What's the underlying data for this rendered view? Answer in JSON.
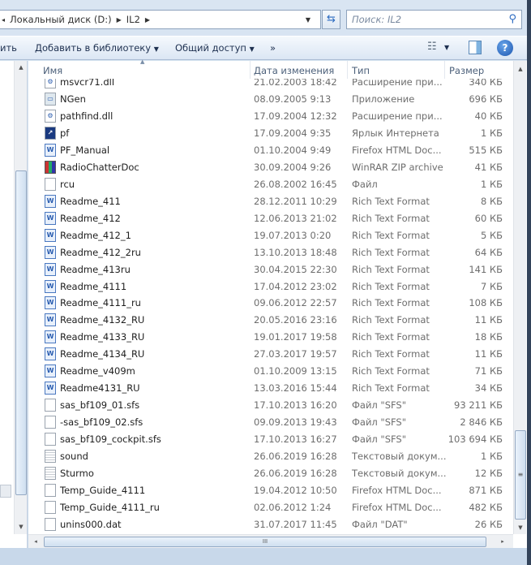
{
  "address": {
    "parts": [
      "Локальный диск (D:)",
      "IL2"
    ]
  },
  "search": {
    "placeholder": "Поиск: IL2"
  },
  "toolbar": {
    "cut_label": "ить",
    "library_label": "Добавить в библиотеку",
    "share_label": "Общий доступ",
    "more_label": "»"
  },
  "columns": {
    "name": "Имя",
    "date": "Дата изменения",
    "type": "Тип",
    "size": "Размер"
  },
  "files": [
    {
      "name": "msvcr71.dll",
      "date": "21.02.2003 18:42",
      "type": "Расширение при...",
      "size": "340 КБ",
      "icon": "dll"
    },
    {
      "name": "NGen",
      "date": "08.09.2005 9:13",
      "type": "Приложение",
      "size": "696 КБ",
      "icon": "app"
    },
    {
      "name": "pathfind.dll",
      "date": "17.09.2004 12:32",
      "type": "Расширение при...",
      "size": "40 КБ",
      "icon": "dll"
    },
    {
      "name": "pf",
      "date": "17.09.2004 9:35",
      "type": "Ярлык Интернета",
      "size": "1 КБ",
      "icon": "url"
    },
    {
      "name": "PF_Manual",
      "date": "01.10.2004 9:49",
      "type": "Firefox HTML Doc...",
      "size": "515 КБ",
      "icon": "rtf"
    },
    {
      "name": "RadioChatterDoc",
      "date": "30.09.2004 9:26",
      "type": "WinRAR ZIP archive",
      "size": "41 КБ",
      "icon": "rar"
    },
    {
      "name": "rcu",
      "date": "26.08.2002 16:45",
      "type": "Файл",
      "size": "1 КБ",
      "icon": "file"
    },
    {
      "name": "Readme_411",
      "date": "28.12.2011 10:29",
      "type": "Rich Text Format",
      "size": "8 КБ",
      "icon": "rtf"
    },
    {
      "name": "Readme_412",
      "date": "12.06.2013 21:02",
      "type": "Rich Text Format",
      "size": "60 КБ",
      "icon": "rtf"
    },
    {
      "name": "Readme_412_1",
      "date": "19.07.2013 0:20",
      "type": "Rich Text Format",
      "size": "5 КБ",
      "icon": "rtf"
    },
    {
      "name": "Readme_412_2ru",
      "date": "13.10.2013 18:48",
      "type": "Rich Text Format",
      "size": "64 КБ",
      "icon": "rtf"
    },
    {
      "name": "Readme_413ru",
      "date": "30.04.2015 22:30",
      "type": "Rich Text Format",
      "size": "141 КБ",
      "icon": "rtf"
    },
    {
      "name": "Readme_4111",
      "date": "17.04.2012 23:02",
      "type": "Rich Text Format",
      "size": "7 КБ",
      "icon": "rtf"
    },
    {
      "name": "Readme_4111_ru",
      "date": "09.06.2012 22:57",
      "type": "Rich Text Format",
      "size": "108 КБ",
      "icon": "rtf"
    },
    {
      "name": "Readme_4132_RU",
      "date": "20.05.2016 23:16",
      "type": "Rich Text Format",
      "size": "11 КБ",
      "icon": "rtf"
    },
    {
      "name": "Readme_4133_RU",
      "date": "19.01.2017 19:58",
      "type": "Rich Text Format",
      "size": "18 КБ",
      "icon": "rtf"
    },
    {
      "name": "Readme_4134_RU",
      "date": "27.03.2017 19:57",
      "type": "Rich Text Format",
      "size": "11 КБ",
      "icon": "rtf"
    },
    {
      "name": "Readme_v409m",
      "date": "01.10.2009 13:15",
      "type": "Rich Text Format",
      "size": "71 КБ",
      "icon": "rtf"
    },
    {
      "name": "Readme4131_RU",
      "date": "13.03.2016 15:44",
      "type": "Rich Text Format",
      "size": "34 КБ",
      "icon": "rtf"
    },
    {
      "name": "sas_bf109_01.sfs",
      "date": "17.10.2013 16:20",
      "type": "Файл \"SFS\"",
      "size": "93 211 КБ",
      "icon": "file"
    },
    {
      "name": "-sas_bf109_02.sfs",
      "date": "09.09.2013 19:43",
      "type": "Файл \"SFS\"",
      "size": "2 846 КБ",
      "icon": "file"
    },
    {
      "name": "sas_bf109_cockpit.sfs",
      "date": "17.10.2013 16:27",
      "type": "Файл \"SFS\"",
      "size": "103 694 КБ",
      "icon": "file"
    },
    {
      "name": "sound",
      "date": "26.06.2019 16:28",
      "type": "Текстовый докум...",
      "size": "1 КБ",
      "icon": "txt"
    },
    {
      "name": "Sturmo",
      "date": "26.06.2019 16:28",
      "type": "Текстовый докум...",
      "size": "12 КБ",
      "icon": "txt"
    },
    {
      "name": "Temp_Guide_4111",
      "date": "19.04.2012 10:50",
      "type": "Firefox HTML Doc...",
      "size": "871 КБ",
      "icon": "file"
    },
    {
      "name": "Temp_Guide_4111_ru",
      "date": "02.06.2012 1:24",
      "type": "Firefox HTML Doc...",
      "size": "482 КБ",
      "icon": "file"
    },
    {
      "name": "unins000.dat",
      "date": "31.07.2017 11:45",
      "type": "Файл \"DAT\"",
      "size": "26 КБ",
      "icon": "file"
    }
  ]
}
